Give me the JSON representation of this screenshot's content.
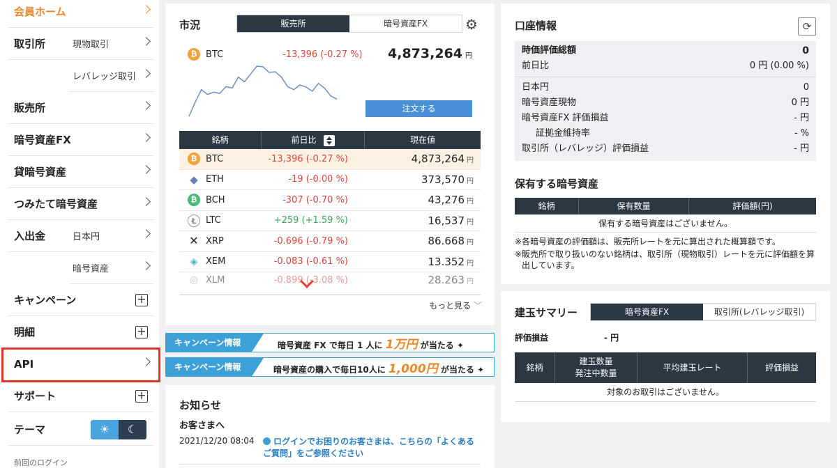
{
  "sidebar": {
    "home": "会員ホーム",
    "exchange": "取引所",
    "spot": "現物取引",
    "leverage": "レバレッジ取引",
    "sales": "販売所",
    "cfx": "暗号資産FX",
    "lending": "貸暗号資産",
    "tsumitate": "つみたて暗号資産",
    "deposit": "入出金",
    "jpy": "日本円",
    "crypto": "暗号資産",
    "campaign": "キャンペーン",
    "statement": "明細",
    "api": "API",
    "support": "サポート",
    "theme": "テーマ",
    "last_login": "前回のログイン",
    "plus_symbol": "+"
  },
  "market": {
    "title": "市況",
    "tab_sales": "販売所",
    "tab_fx": "暗号資産FX",
    "top_symbol": "BTC",
    "top_change": "-13,396 (-0.27 %)",
    "top_price": "4,873,264",
    "yen": "円",
    "order_button": "注文する",
    "col_name": "銘柄",
    "col_change": "前日比",
    "col_price": "現在値",
    "rows": [
      {
        "symbol": "BTC",
        "change": "-13,396 (-0.27 %)",
        "price": "4,873,264",
        "dir": "neg"
      },
      {
        "symbol": "ETH",
        "change": "-19 (-0.00 %)",
        "price": "373,570",
        "dir": "neg"
      },
      {
        "symbol": "BCH",
        "change": "-307 (-0.70 %)",
        "price": "43,276",
        "dir": "neg"
      },
      {
        "symbol": "LTC",
        "change": "+259 (+1.59 %)",
        "price": "16,537",
        "dir": "pos"
      },
      {
        "symbol": "XRP",
        "change": "-0.696 (-0.79 %)",
        "price": "86.668",
        "dir": "neg"
      },
      {
        "symbol": "XEM",
        "change": "-0.083 (-0.61 %)",
        "price": "13.352",
        "dir": "neg"
      },
      {
        "symbol": "XLM",
        "change": "-0.899 (-3.08 %)",
        "price": "28.263",
        "dir": "neg"
      }
    ],
    "more": "もっと見る"
  },
  "banners": [
    {
      "tag": "キャンペーン情報",
      "pre": "暗号資産 FX で毎日 1 人に",
      "big": "1万円",
      "post": "が当たる"
    },
    {
      "tag": "キャンペーン情報",
      "pre": "暗号資産の購入で毎日10人に",
      "big": "1,000円",
      "post": "が当たる"
    }
  ],
  "news": {
    "title": "お知らせ",
    "sub": "お客さまへ",
    "date": "2021/12/20 08:04",
    "text": "ログインでお困りのお客さまは、こちらの「よくあるご質問」をご参照ください"
  },
  "account": {
    "title": "口座情報",
    "total_label": "時価評価総額",
    "total_value": "0",
    "prev_label": "前日比",
    "prev_value": "0 円 (0.00 %)",
    "jpy_label": "日本円",
    "jpy_value": "0",
    "spot_label": "暗号資産現物",
    "spot_value": "0 円",
    "fx_label": "暗号資産FX 評価損益",
    "fx_value": "- 円",
    "margin_label": "証拠金維持率",
    "margin_value": "- %",
    "lev_label": "取引所（レバレッジ）評価損益",
    "lev_value": "- 円"
  },
  "holdings": {
    "title": "保有する暗号資産",
    "col_name": "銘柄",
    "col_qty": "保有数量",
    "col_value": "評価額(円)",
    "empty": "保有する暗号資産はございません。",
    "note1": "※各暗号資産の評価額は、販売所レートを元に算出された概算額です。",
    "note2": "※販売所で取り扱いのない銘柄は、取引所（現物取引）レートを元に評価額を算出しています。"
  },
  "positions": {
    "title": "建玉サマリー",
    "tab_fx": "暗号資産FX",
    "tab_lev": "取引所(レバレッジ取引)",
    "pl_label": "評価損益",
    "pl_value": "- 円",
    "col_name": "銘柄",
    "col_qty1": "建玉数量",
    "col_qty2": "発注中数量",
    "col_rate": "平均建玉レート",
    "col_pl": "評価損益",
    "empty": "対象のお取引はございません。"
  },
  "chart_data": {
    "type": "line",
    "title": "",
    "xlabel": "",
    "ylabel": "",
    "values": [
      4745000,
      4790000,
      4830000,
      4815000,
      4822000,
      4818000,
      4840000,
      4835000,
      4870000,
      4855000,
      4880000,
      4905000,
      4903000,
      4885000,
      4887000,
      4870000,
      4840000,
      4830000,
      4845000,
      4838000,
      4825000,
      4850000,
      4835000,
      4810000,
      4800000
    ]
  },
  "colors": {
    "accent": "#3da0d6",
    "dark": "#2c3744",
    "negative": "#d9473b",
    "positive": "#3aa55a",
    "home_accent": "#e8892e",
    "highlight": "#e0382c"
  }
}
